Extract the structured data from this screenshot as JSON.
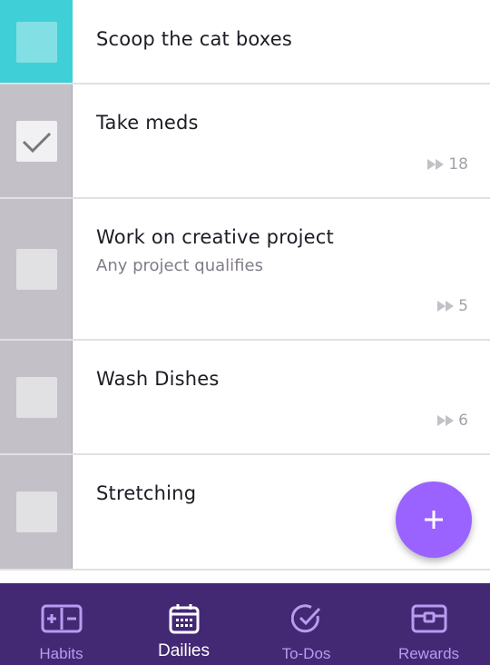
{
  "tasks": [
    {
      "title": "Scoop the cat boxes",
      "notes": "",
      "streak": "",
      "checked": false,
      "due": true
    },
    {
      "title": "Take meds",
      "notes": "",
      "streak": "18",
      "checked": true,
      "due": false
    },
    {
      "title": "Work on creative project",
      "notes": "Any project qualifies",
      "streak": "5",
      "checked": false,
      "due": false
    },
    {
      "title": "Wash Dishes",
      "notes": "",
      "streak": "6",
      "checked": false,
      "due": false
    },
    {
      "title": "Stretching",
      "notes": "",
      "streak": "",
      "checked": false,
      "due": false
    }
  ],
  "fab": {
    "icon": "plus-icon"
  },
  "nav": {
    "habits": {
      "label": "Habits",
      "icon": "habits-icon"
    },
    "dailies": {
      "label": "Dailies",
      "icon": "calendar-icon"
    },
    "todos": {
      "label": "To-Dos",
      "icon": "check-circle-icon"
    },
    "rewards": {
      "label": "Rewards",
      "icon": "treasure-chest-icon"
    }
  },
  "colors": {
    "nav_background": "#432874",
    "nav_inactive": "#b79cf0",
    "fab": "#9a62ff",
    "due_accent": "#3fcfd6",
    "task_gutter": "#c3c0c7"
  }
}
